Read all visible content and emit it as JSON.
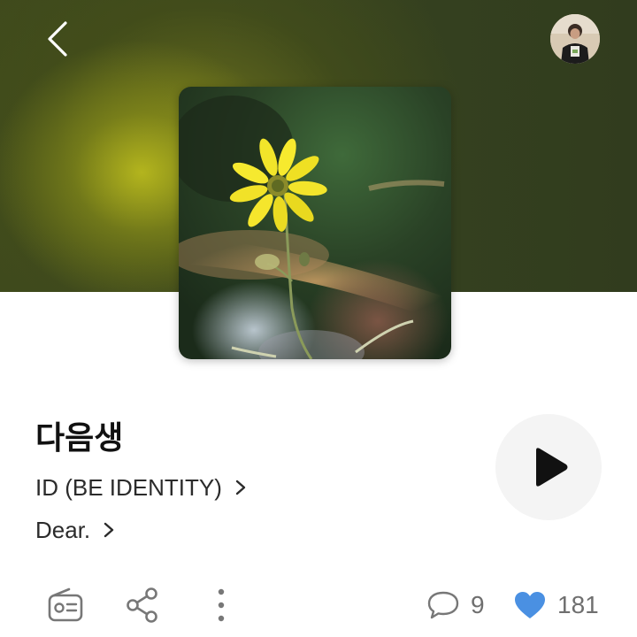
{
  "header": {
    "back_icon": "chevron-left-icon",
    "avatar_icon": "user-avatar"
  },
  "track": {
    "title": "다음생",
    "artist": "ID (BE IDENTITY)",
    "album": "Dear."
  },
  "album_art": {
    "description_icon": "yellow-flower-photo"
  },
  "actions": {
    "play_icon": "play-icon",
    "radio_icon": "radio-icon",
    "share_icon": "share-icon",
    "more_icon": "more-vertical-icon"
  },
  "stats": {
    "comments_count": "9",
    "likes_count": "181",
    "comment_icon": "comment-bubble-icon",
    "like_icon": "heart-icon",
    "like_color": "#4a90e2"
  }
}
